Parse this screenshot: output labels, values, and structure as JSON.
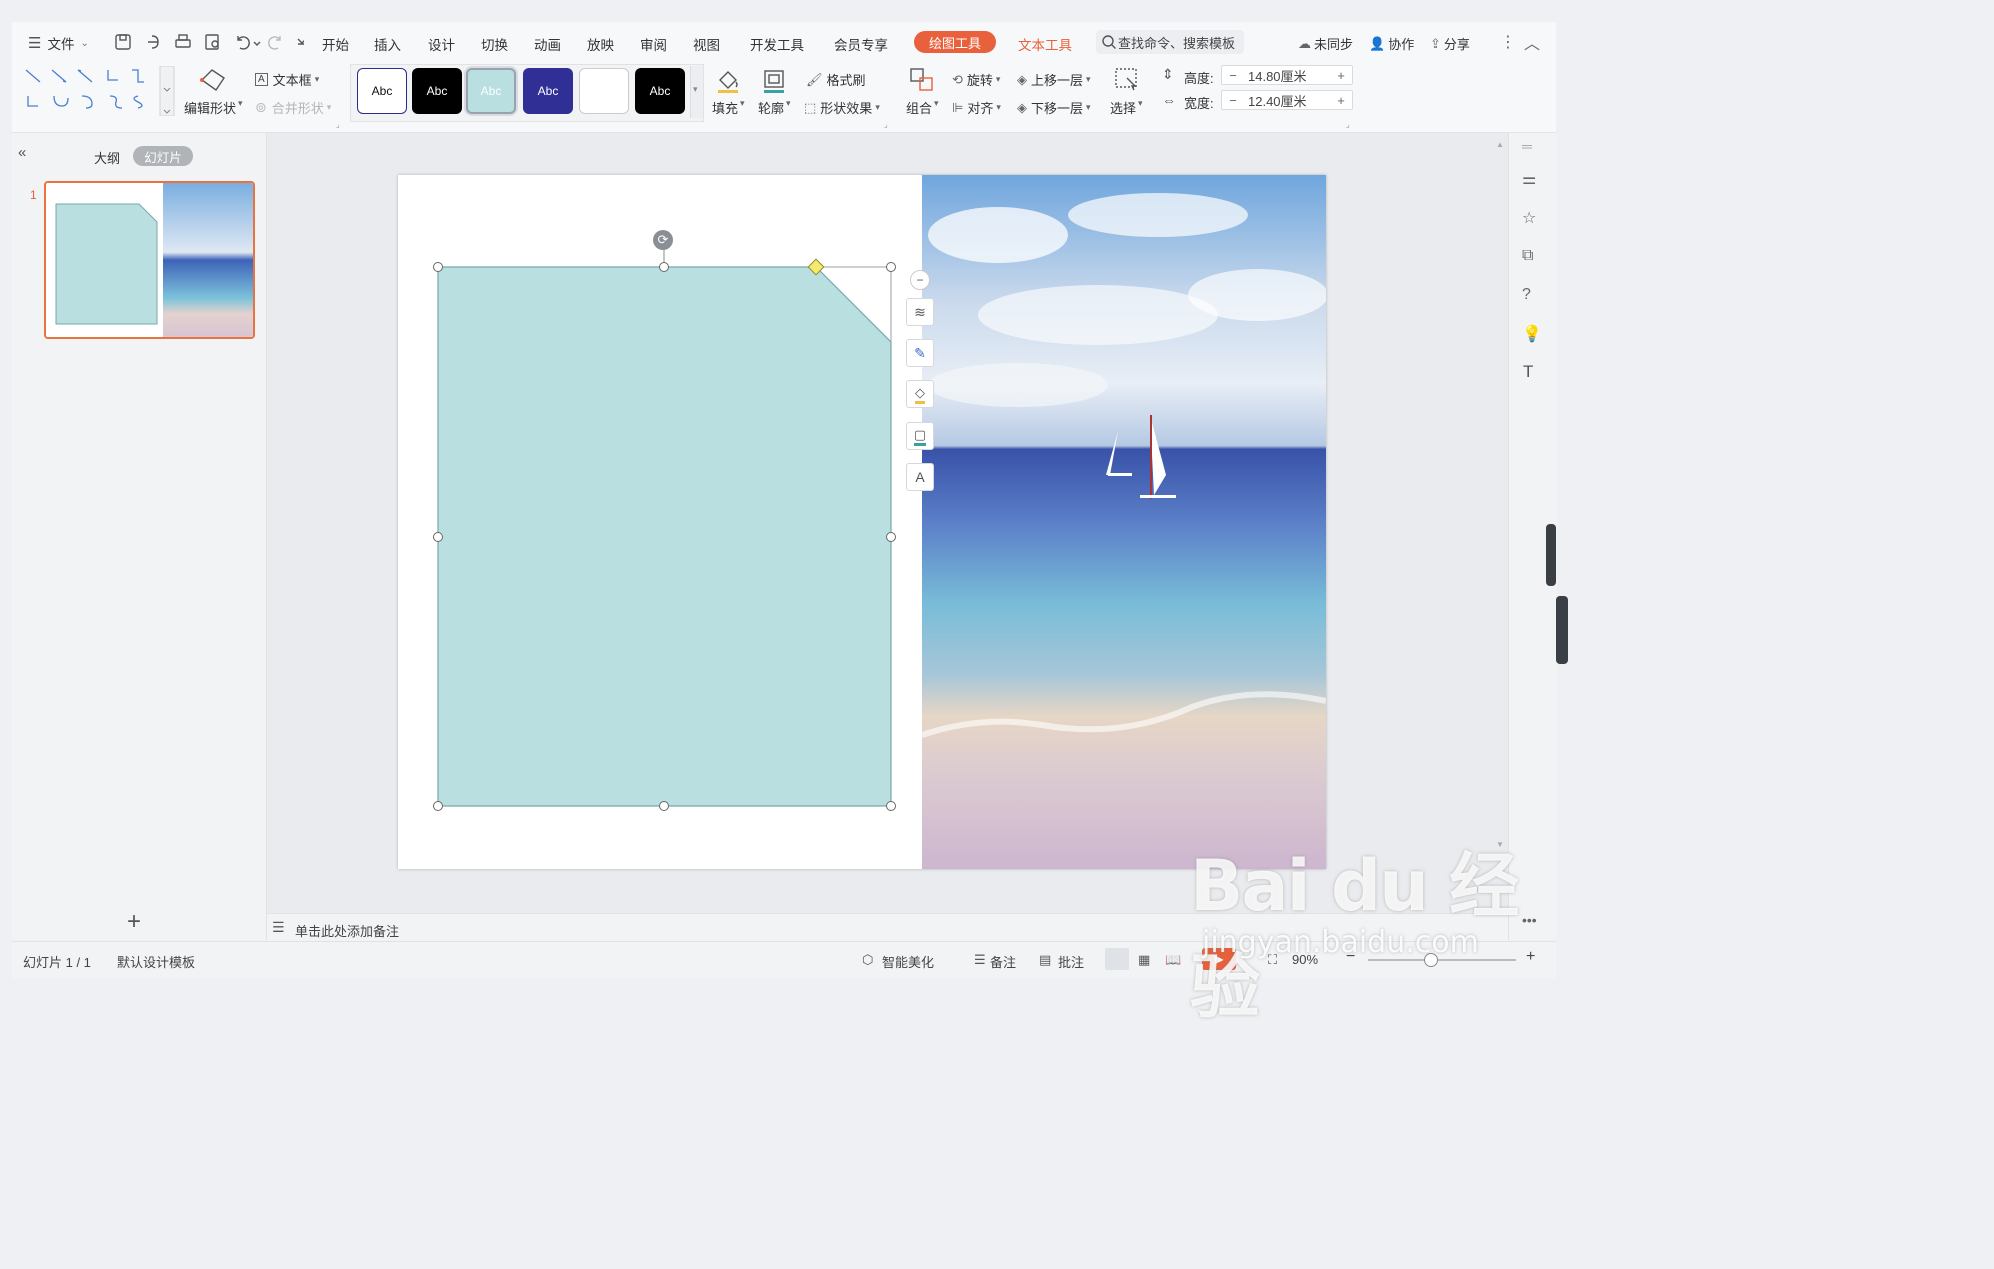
{
  "menubar": {
    "file_label": "文件",
    "tabs": [
      "开始",
      "插入",
      "设计",
      "切换",
      "动画",
      "放映",
      "审阅",
      "视图",
      "开发工具",
      "会员专享"
    ],
    "active_tab": "绘图工具",
    "extra_tab": "文本工具",
    "search_placeholder": "查找命令、搜索模板",
    "sync_label": "未同步",
    "collab_label": "协作",
    "share_label": "分享"
  },
  "ribbon": {
    "edit_shape": "编辑形状",
    "textbox": "文本框",
    "merge_shape": "合并形状",
    "style_samples": [
      "Abc",
      "Abc",
      "Abc",
      "Abc",
      "",
      "Abc"
    ],
    "fill": "填充",
    "outline": "轮廓",
    "format_painter": "格式刷",
    "shape_effect": "形状效果",
    "group": "组合",
    "rotate": "旋转",
    "align": "对齐",
    "bring_forward": "上移一层",
    "send_backward": "下移一层",
    "select": "选择",
    "height_label": "高度:",
    "height_value": "14.80厘米",
    "width_label": "宽度:",
    "width_value": "12.40厘米"
  },
  "left_panel": {
    "outline_tab": "大纲",
    "slides_tab": "幻灯片",
    "slide_number": "1"
  },
  "notes": {
    "placeholder": "单击此处添加备注"
  },
  "statusbar": {
    "slide_info": "幻灯片 1 / 1",
    "template": "默认设计模板",
    "beautify": "智能美化",
    "notes": "备注",
    "comments": "批注",
    "zoom": "90%"
  },
  "watermark": {
    "logo": "Bai du 经验",
    "url": "jingyan.baidu.com"
  },
  "colors": {
    "accent": "#e8613c",
    "shape_fill": "#b9dfe0",
    "shape_stroke": "#7aa8a8"
  }
}
